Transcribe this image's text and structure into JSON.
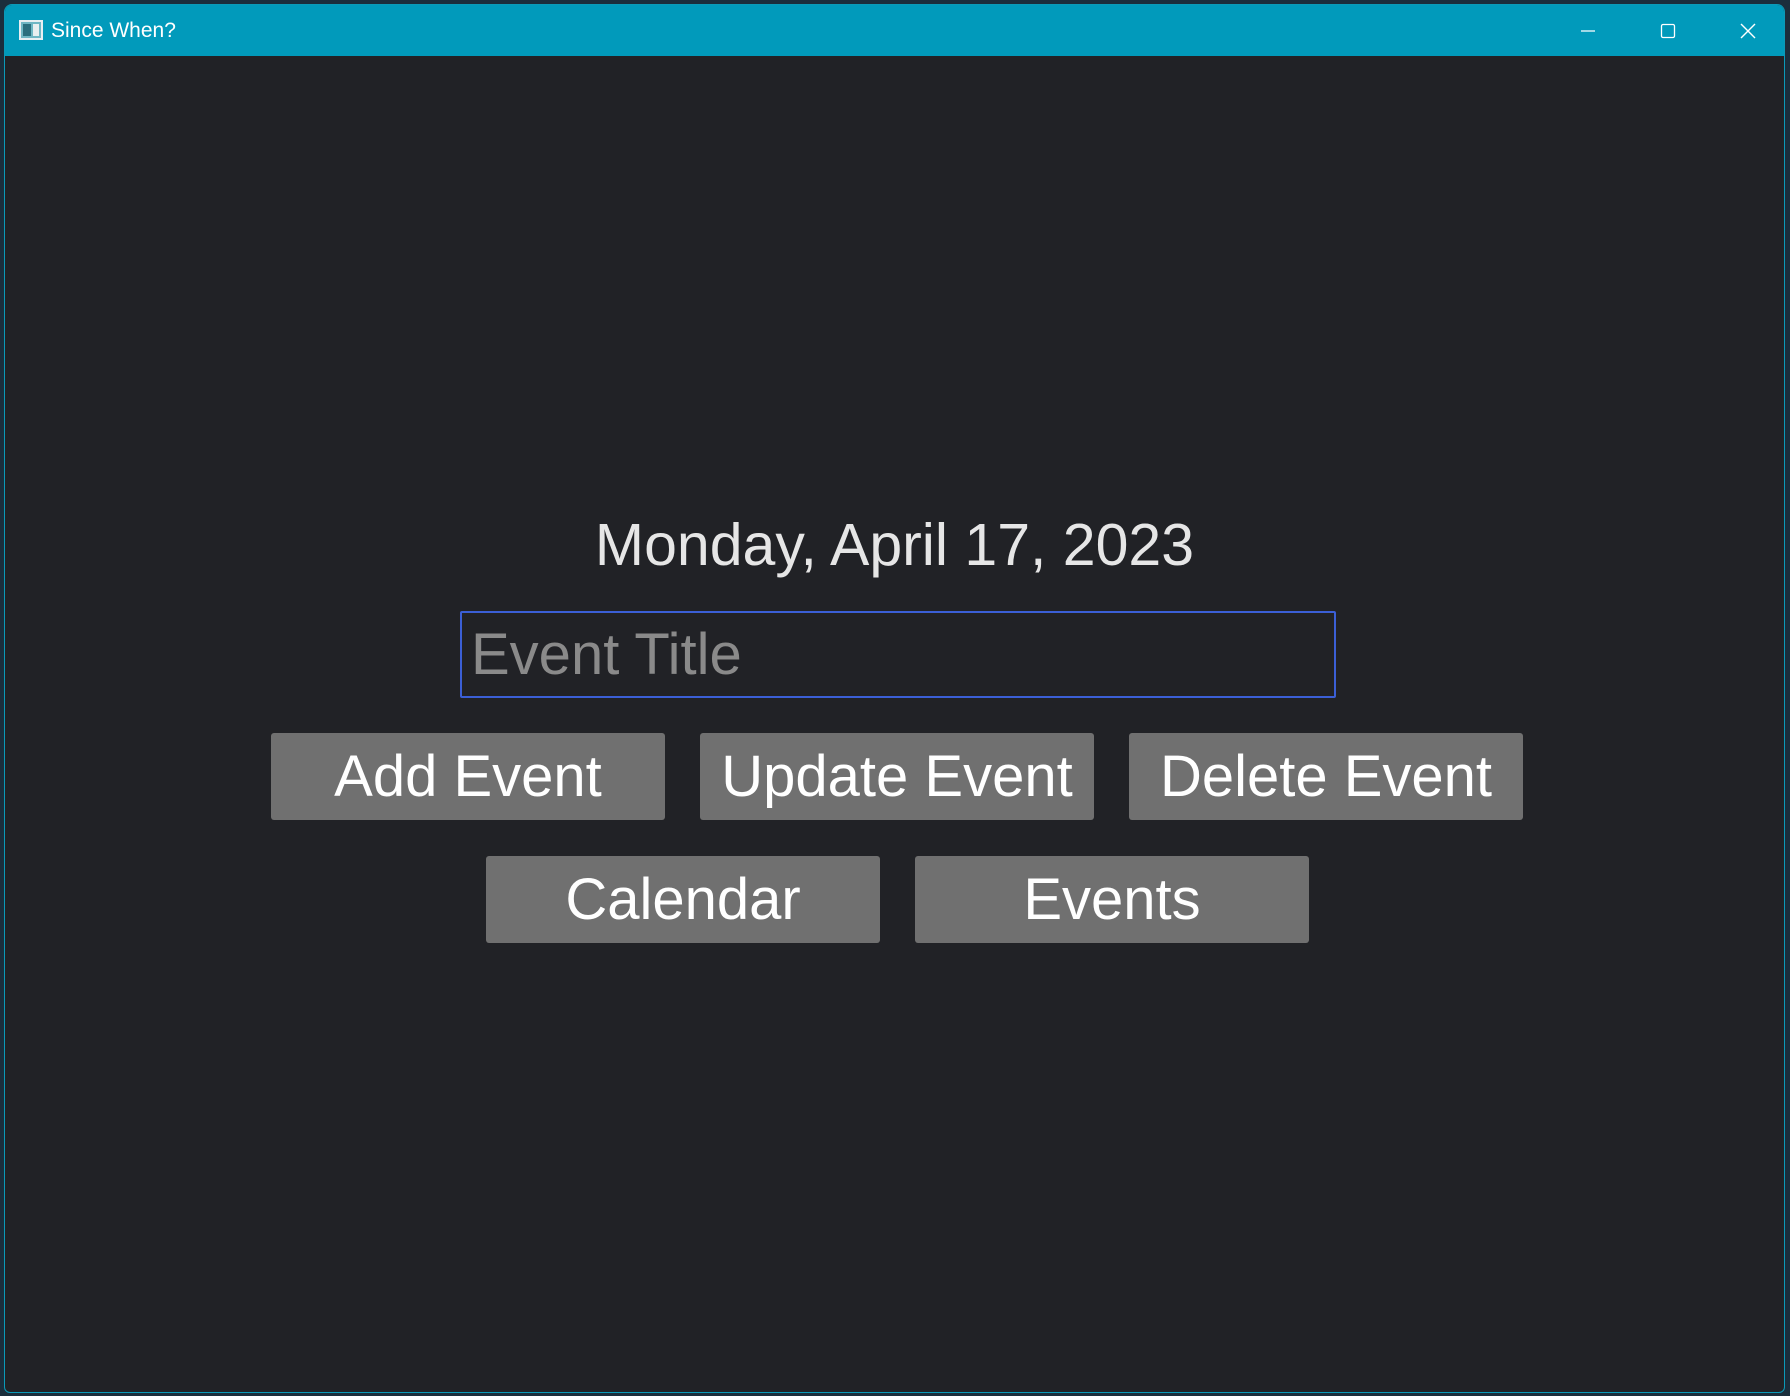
{
  "window": {
    "title": "Since When?",
    "icon": "app-window-icon",
    "controls": {
      "minimize_icon": "minimize-icon",
      "maximize_icon": "maximize-icon",
      "close_icon": "close-icon"
    },
    "colors": {
      "titlebar": "#019abb",
      "background": "#212226",
      "button": "#707070",
      "input_border": "#3b5fd6"
    }
  },
  "main": {
    "date": "Monday, April 17, 2023",
    "event_title_input": {
      "value": "",
      "placeholder": "Event Title"
    },
    "buttons": {
      "add": "Add Event",
      "update": "Update Event",
      "delete": "Delete Event",
      "calendar": "Calendar",
      "events": "Events"
    }
  }
}
